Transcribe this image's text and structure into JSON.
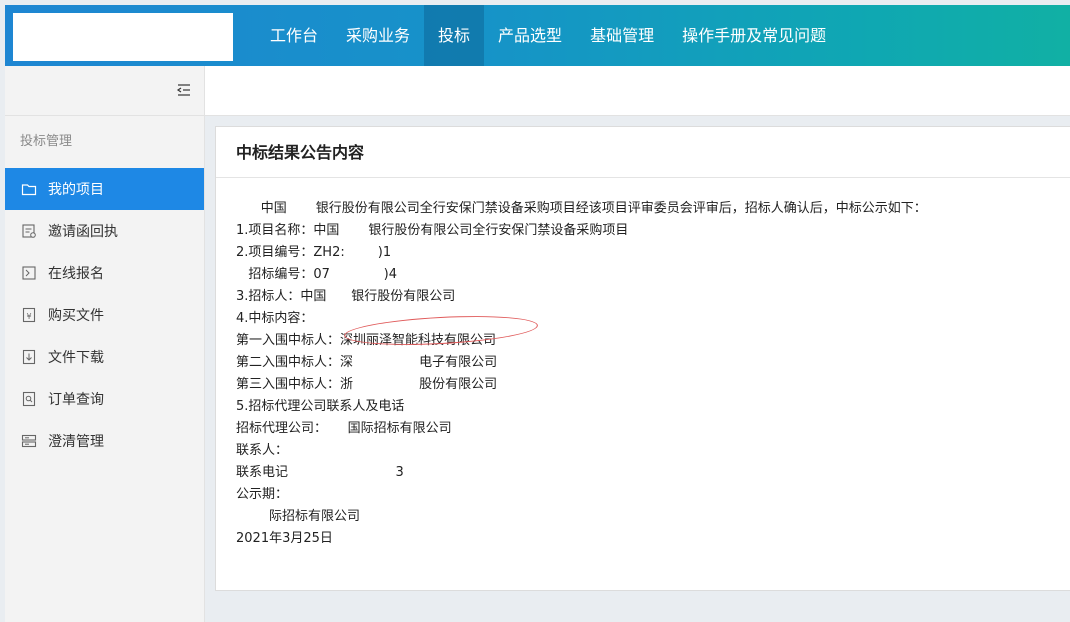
{
  "header": {
    "nav": [
      {
        "label": "工作台",
        "active": false
      },
      {
        "label": "采购业务",
        "active": false
      },
      {
        "label": "投标",
        "active": true
      },
      {
        "label": "产品选型",
        "active": false
      },
      {
        "label": "基础管理",
        "active": false
      },
      {
        "label": "操作手册及常见问题",
        "active": false
      }
    ]
  },
  "sidebar": {
    "collapse_icon": "menu-fold-icon",
    "group_label": "投标管理",
    "items": [
      {
        "label": "我的项目",
        "icon": "folder-icon",
        "active": true
      },
      {
        "label": "邀请函回执",
        "icon": "receipt-icon",
        "active": false
      },
      {
        "label": "在线报名",
        "icon": "signup-icon",
        "active": false
      },
      {
        "label": "购买文件",
        "icon": "purchase-file-icon",
        "active": false
      },
      {
        "label": "文件下载",
        "icon": "download-file-icon",
        "active": false
      },
      {
        "label": "订单查询",
        "icon": "order-search-icon",
        "active": false
      },
      {
        "label": "澄清管理",
        "icon": "clarify-icon",
        "active": false
      }
    ]
  },
  "content": {
    "title": "中标结果公告内容",
    "lines": [
      "      中国       银行股份有限公司全行安保门禁设备采购项目经该项目评审委员会评审后，招标人确认后，中标公示如下：",
      "1.项目名称：中国       银行股份有限公司全行安保门禁设备采购项目",
      "2.项目编号：ZH2:        )1",
      "   招标编号：07             )4",
      "3.招标人：中国      银行股份有限公司",
      "4.中标内容：",
      "第一入围中标人：深圳丽泽智能科技有限公司",
      "第二入围中标人：深                电子有限公司",
      "第三入围中标人：浙                股份有限公司",
      "5.招标代理公司联系人及电话",
      "招标代理公司：     国际招标有限公司",
      "联系人：",
      "联系电记                          3",
      "公示期：",
      "        际招标有限公司",
      "2021年3月25日"
    ]
  }
}
